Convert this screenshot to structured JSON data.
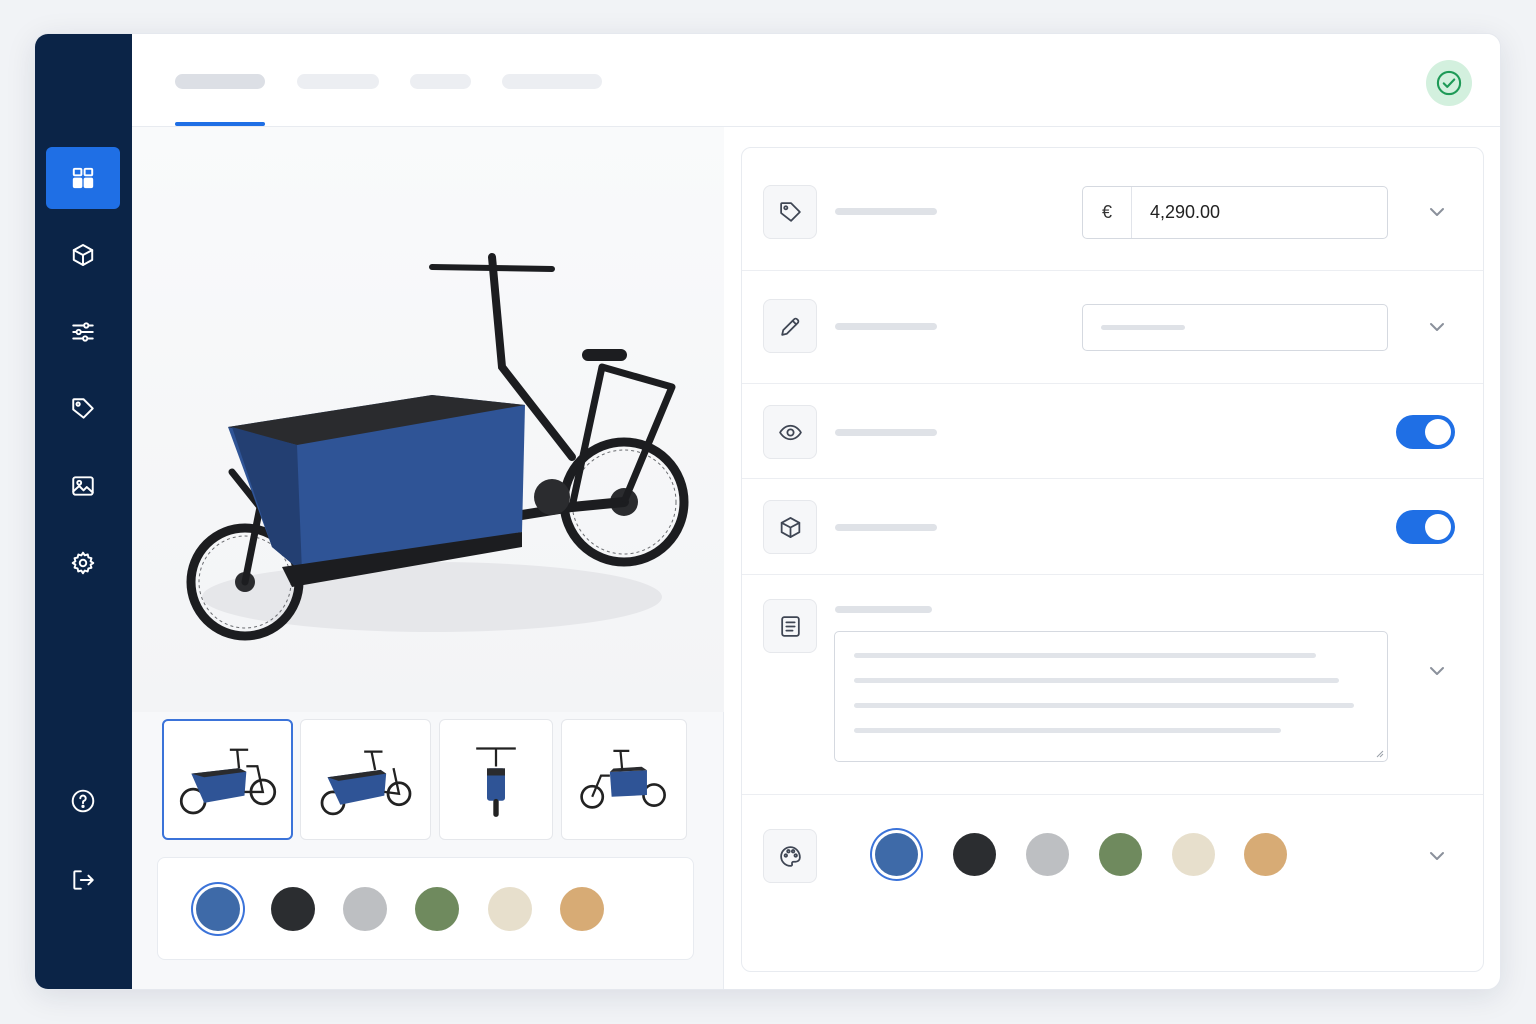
{
  "sidebar": {
    "items": [
      {
        "name": "dashboard-icon",
        "active": true
      },
      {
        "name": "cube-icon",
        "active": false
      },
      {
        "name": "sliders-icon",
        "active": false
      },
      {
        "name": "tag-icon",
        "active": false
      },
      {
        "name": "image-icon",
        "active": false
      },
      {
        "name": "gear-icon",
        "active": false
      },
      {
        "name": "help-icon",
        "active": false
      },
      {
        "name": "logout-icon",
        "active": false
      }
    ]
  },
  "header": {
    "active_tab_index": 0,
    "status_icon": "check-circle-icon",
    "status_color": "#1e9a57"
  },
  "product": {
    "gallery_selected_index": 0,
    "thumbnail_count": 4
  },
  "form": {
    "price": {
      "icon": "tag-icon",
      "currency": "€",
      "value": "4,290.00"
    },
    "name": {
      "icon": "pencil-icon"
    },
    "visibility": {
      "icon": "eye-icon",
      "enabled": true
    },
    "stock": {
      "icon": "box-icon",
      "enabled": true
    },
    "description": {
      "icon": "document-icon"
    },
    "color": {
      "icon": "palette-icon"
    }
  },
  "colors": {
    "accent": "#1f6fe5",
    "sidebar": "#0b2447",
    "swatches": [
      {
        "name": "blue",
        "hex": "#3e6aa8",
        "selected": true
      },
      {
        "name": "black",
        "hex": "#2b2d30",
        "selected": false
      },
      {
        "name": "silver",
        "hex": "#bdbfc2",
        "selected": false
      },
      {
        "name": "olive",
        "hex": "#6f8a5e",
        "selected": false
      },
      {
        "name": "cream",
        "hex": "#e7dfcc",
        "selected": false
      },
      {
        "name": "wood",
        "hex": "#d7ab75",
        "selected": false
      }
    ]
  }
}
